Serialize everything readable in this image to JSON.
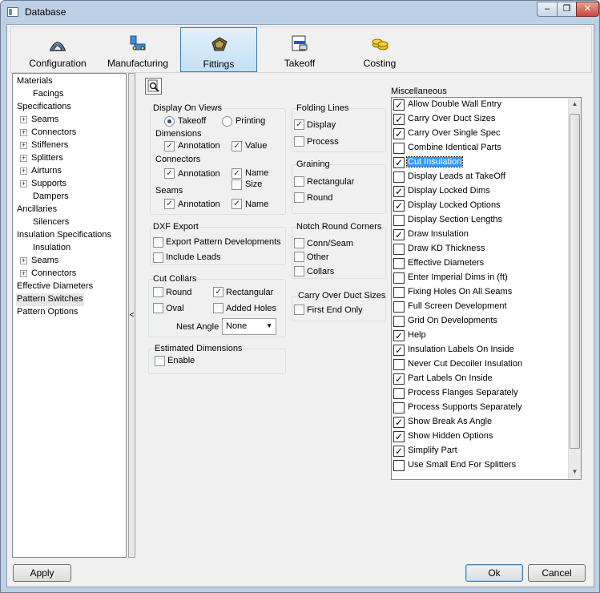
{
  "window": {
    "title": "Database",
    "close_glyph": "✕",
    "max_glyph": "❐",
    "min_glyph": "‒"
  },
  "toolbar": [
    {
      "label": "Configuration",
      "icon": "configuration-icon"
    },
    {
      "label": "Manufacturing",
      "icon": "manufacturing-icon"
    },
    {
      "label": "Fittings",
      "icon": "fittings-icon"
    },
    {
      "label": "Takeoff",
      "icon": "takeoff-icon"
    },
    {
      "label": "Costing",
      "icon": "costing-icon"
    }
  ],
  "tree": [
    "Materials",
    "Facings",
    "Specifications",
    "Seams",
    "Connectors",
    "Stiffeners",
    "Splitters",
    "Airturns",
    "Supports",
    "Dampers",
    "Ancillaries",
    "Silencers",
    "Insulation Specifications",
    "Insulation",
    "Seams",
    "Connectors",
    "Effective Diameters",
    "Pattern Switches",
    "Pattern Options"
  ],
  "expander": "+",
  "splitter_glyph": "<",
  "display_on_views": {
    "title": "Display On Views",
    "takeoff": "Takeoff",
    "printing": "Printing",
    "dimensions": "Dimensions",
    "annotation1": "Annotation",
    "value": "Value",
    "connectors": "Connectors",
    "annotation2": "Annotation",
    "name1": "Name",
    "size": "Size",
    "seams": "Seams",
    "annotation3": "Annotation",
    "name2": "Name"
  },
  "dxf_export": {
    "title": "DXF Export",
    "export_pattern": "Export Pattern Developments",
    "include_leads": "Include Leads"
  },
  "cut_collars": {
    "title": "Cut Collars",
    "round": "Round",
    "rectangular": "Rectangular",
    "oval": "Oval",
    "added_holes": "Added Holes",
    "nest_angle": "Nest Angle",
    "nest_value": "None"
  },
  "estimated_dimensions": {
    "title": "Estimated Dimensions",
    "enable": "Enable"
  },
  "folding_lines": {
    "title": "Folding Lines",
    "display": "Display",
    "process": "Process"
  },
  "graining": {
    "title": "Graining",
    "rectangular": "Rectangular",
    "round": "Round"
  },
  "notch": {
    "title": "Notch Round Corners",
    "conn_seam": "Conn/Seam",
    "other": "Other",
    "collars": "Collars"
  },
  "carry_over": {
    "title": "Carry Over Duct Sizes",
    "first_end": "First End Only"
  },
  "misc": {
    "title": "Miscellaneous",
    "items": [
      {
        "label": "Allow Double Wall Entry",
        "checked": true
      },
      {
        "label": "Carry Over Duct Sizes",
        "checked": true
      },
      {
        "label": "Carry Over Single Spec",
        "checked": true
      },
      {
        "label": "Combine Identical Parts",
        "checked": false
      },
      {
        "label": "Cut Insulation",
        "checked": true
      },
      {
        "label": "Display Leads at TakeOff",
        "checked": false
      },
      {
        "label": "Display Locked Dims",
        "checked": true
      },
      {
        "label": "Display Locked Options",
        "checked": true
      },
      {
        "label": "Display Section Lengths",
        "checked": false
      },
      {
        "label": "Draw Insulation",
        "checked": true
      },
      {
        "label": "Draw KD Thickness",
        "checked": false
      },
      {
        "label": "Effective Diameters",
        "checked": false
      },
      {
        "label": "Enter Imperial Dims in (ft)",
        "checked": false
      },
      {
        "label": "Fixing Holes On All Seams",
        "checked": false
      },
      {
        "label": "Full Screen Development",
        "checked": false
      },
      {
        "label": "Grid On Developments",
        "checked": false
      },
      {
        "label": "Help",
        "checked": true
      },
      {
        "label": "Insulation Labels On Inside",
        "checked": true
      },
      {
        "label": "Never Cut Decoiler Insulation",
        "checked": false
      },
      {
        "label": "Part Labels On Inside",
        "checked": true
      },
      {
        "label": "Process Flanges Separately",
        "checked": false
      },
      {
        "label": "Process Supports Separately",
        "checked": false
      },
      {
        "label": "Show Break As Angle",
        "checked": true
      },
      {
        "label": "Show Hidden Options",
        "checked": true
      },
      {
        "label": "Simplify Part",
        "checked": true
      },
      {
        "label": "Use Small End For Splitters",
        "checked": false
      }
    ]
  },
  "checkmark": "✓",
  "scroll": {
    "up": "▲",
    "down": "▼"
  },
  "buttons": {
    "apply": "Apply",
    "ok": "Ok",
    "cancel": "Cancel"
  }
}
